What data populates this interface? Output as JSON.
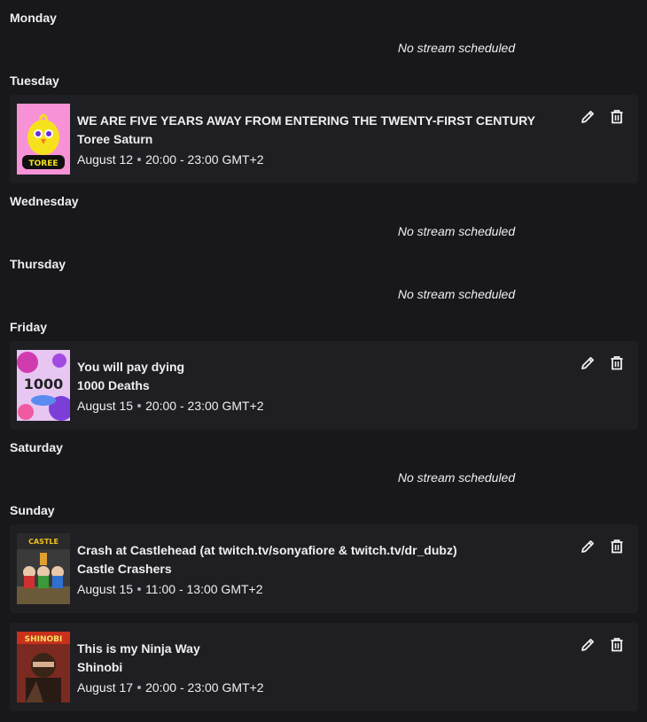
{
  "days": [
    {
      "label": "Monday",
      "empty": "No stream scheduled"
    },
    {
      "label": "Tuesday"
    },
    {
      "label": "Wednesday",
      "empty": "No stream scheduled"
    },
    {
      "label": "Thursday",
      "empty": "No stream scheduled"
    },
    {
      "label": "Friday"
    },
    {
      "label": "Saturday",
      "empty": "No stream scheduled"
    },
    {
      "label": "Sunday"
    }
  ],
  "streams": [
    {
      "title": "WE ARE FIVE YEARS AWAY FROM ENTERING THE TWENTY-FIRST CENTURY",
      "game": "Toree Saturn",
      "date": "August 12",
      "time": "20:00 - 23:00 GMT+2",
      "thumb_text": "TOREE"
    },
    {
      "title": "You will pay dying",
      "game": "1000 Deaths",
      "date": "August 15",
      "time": "20:00 - 23:00 GMT+2",
      "thumb_text": "1000"
    },
    {
      "title": "Crash at Castlehead (at twitch.tv/sonyafiore & twitch.tv/dr_dubz)",
      "game": "Castle Crashers",
      "date": "August 15",
      "time": "11:00 - 13:00 GMT+2",
      "thumb_text": "CASTLE"
    },
    {
      "title": "This is my Ninja Way",
      "game": "Shinobi",
      "date": "August 17",
      "time": "20:00 - 23:00 GMT+2",
      "thumb_text": "SHINOBI"
    }
  ],
  "icons": {
    "edit": "pencil-icon",
    "delete": "trash-icon"
  },
  "colors": {
    "background": "#18181b",
    "card": "#1f1f23",
    "text": "#efeff1"
  }
}
